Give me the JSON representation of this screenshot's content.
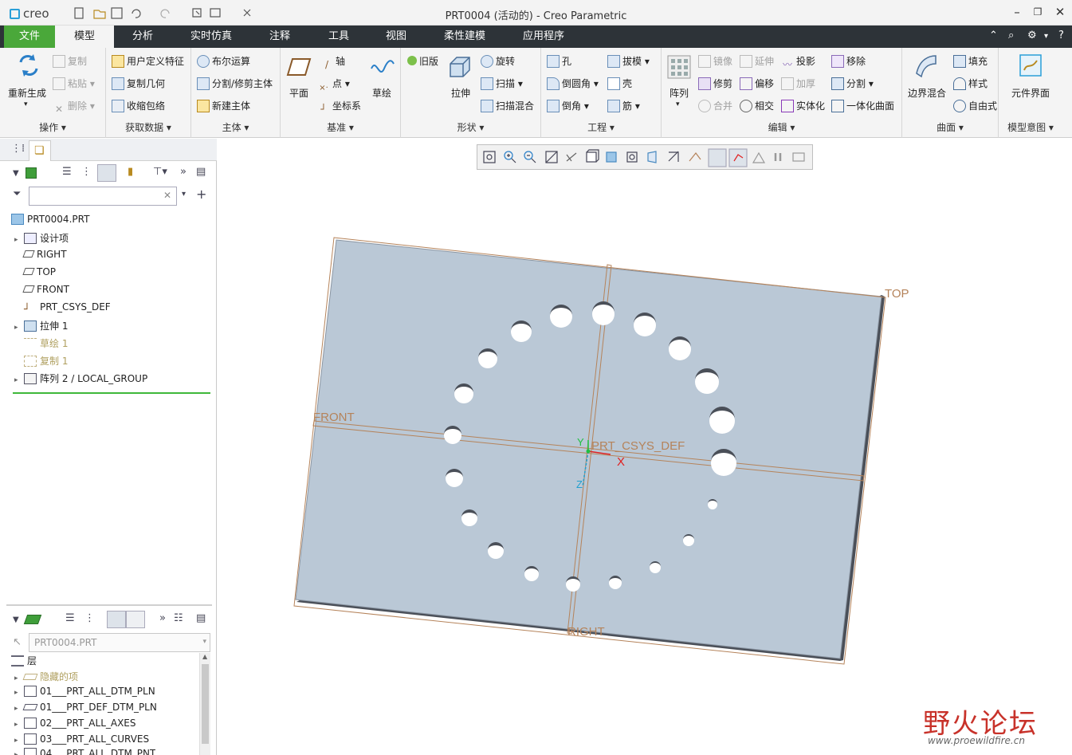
{
  "app": {
    "logo_text": "creo",
    "window_title": "PRT0004 (活动的) - Creo Parametric"
  },
  "tabs": [
    {
      "label": "文件"
    },
    {
      "label": "模型"
    },
    {
      "label": "分析"
    },
    {
      "label": "实时仿真"
    },
    {
      "label": "注释"
    },
    {
      "label": "工具"
    },
    {
      "label": "视图"
    },
    {
      "label": "柔性建模"
    },
    {
      "label": "应用程序"
    }
  ],
  "ribbon": {
    "operations": {
      "label": "操作",
      "regen": "重新生成",
      "copy": "复制",
      "paste": "粘贴",
      "delete": "删除"
    },
    "get_data": {
      "label": "获取数据",
      "udf": "用户定义特征",
      "copy_geom": "复制几何",
      "shrinkwrap": "收缩包络"
    },
    "body": {
      "label": "主体",
      "boolean": "布尔运算",
      "split_trim": "分割/修剪主体",
      "new_body": "新建主体"
    },
    "datum": {
      "label": "基准",
      "plane": "平面",
      "axis": "轴",
      "point": "点",
      "csys": "坐标系",
      "sketch": "草绘"
    },
    "shapes": {
      "label": "形状",
      "legacy": "旧版",
      "extrude": "拉伸",
      "revolve": "旋转",
      "sweep": "扫描",
      "swept_blend": "扫描混合"
    },
    "engineering": {
      "label": "工程",
      "hole": "孔",
      "round": "倒圆角",
      "chamfer": "倒角",
      "draft": "拔模",
      "shell": "壳",
      "rib": "筋"
    },
    "editing": {
      "label": "编辑",
      "pattern": "阵列",
      "mirror": "镜像",
      "trim": "修剪",
      "merge": "合并",
      "extend": "延伸",
      "offset": "偏移",
      "intersect": "相交",
      "project": "投影",
      "thicken": "加厚",
      "solidify": "实体化",
      "remove": "移除",
      "split": "分割",
      "unify": "一体化曲面"
    },
    "surfaces": {
      "label": "曲面",
      "boundary": "边界混合",
      "fill": "填充",
      "style": "样式",
      "freestyle": "自由式"
    },
    "intent": {
      "label": "模型意图",
      "component_interface": "元件界面"
    }
  },
  "model_tree": {
    "items": [
      {
        "label": "PRT0004.PRT",
        "icon": "part-icon"
      },
      {
        "label": "设计项",
        "icon": "design-items-icon"
      },
      {
        "label": "RIGHT",
        "icon": "datum-plane-icon"
      },
      {
        "label": "TOP",
        "icon": "datum-plane-icon"
      },
      {
        "label": "FRONT",
        "icon": "datum-plane-icon"
      },
      {
        "label": "PRT_CSYS_DEF",
        "icon": "csys-icon"
      },
      {
        "label": "拉伸 1",
        "icon": "extrude-icon"
      },
      {
        "label": "草绘 1",
        "icon": "sketch-icon"
      },
      {
        "label": "复制 1",
        "icon": "copy-icon"
      },
      {
        "label": "阵列 2 / LOCAL_GROUP",
        "icon": "pattern-icon"
      }
    ]
  },
  "layer_tree": {
    "selector_value": "PRT0004.PRT",
    "header": "层",
    "items": [
      {
        "label": "隐藏的项"
      },
      {
        "label": "01___PRT_ALL_DTM_PLN"
      },
      {
        "label": "01___PRT_DEF_DTM_PLN"
      },
      {
        "label": "02___PRT_ALL_AXES"
      },
      {
        "label": "03___PRT_ALL_CURVES"
      },
      {
        "label": "04___PRT_ALL_DTM_PNT"
      }
    ]
  },
  "viewport": {
    "labels": {
      "top": "TOP",
      "front": "FRONT",
      "right": "RIGHT",
      "csys": "PRT_CSYS_DEF",
      "x": "X",
      "y": "Y",
      "z": "Z"
    }
  },
  "watermark": {
    "text": "野火论坛",
    "url": "www.proewildfire.cn"
  },
  "colors": {
    "file_tab": "#4aa83a",
    "tab_bar": "#2d3338",
    "plate": "#bac8d6",
    "datum": "#b5835a"
  }
}
